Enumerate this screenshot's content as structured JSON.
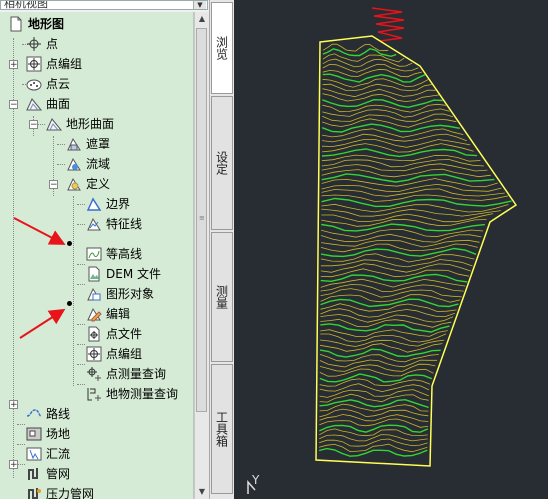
{
  "dropdown": {
    "label": "相机视图"
  },
  "tree": {
    "root": "地形图",
    "points": "点",
    "point_groups": "点编组",
    "point_clouds": "点云",
    "surfaces": "曲面",
    "surface_item": "地形曲面",
    "masks": "遮罩",
    "watersheds": "流域",
    "definition": "定义",
    "boundaries": "边界",
    "breaklines": "特征线",
    "contours": "等高线",
    "dem_files": "DEM 文件",
    "drawing_objects": "图形对象",
    "edits": "编辑",
    "point_files": "点文件",
    "point_groups_sub": "点编组",
    "point_survey_queries": "点测量查询",
    "figure_survey_queries": "地物测量查询",
    "alignments": "路线",
    "sites": "场地",
    "catchments": "汇流",
    "pipe_networks": "管网",
    "pressure_networks": "压力管网"
  },
  "tabs": {
    "browse": "浏览",
    "settings": "设定",
    "survey": "测量",
    "toolbox": "工具箱"
  },
  "canvas": {
    "ucs_axis": "Y"
  },
  "colors": {
    "tree_bg": "#d5ebd5",
    "canvas_bg": "#282c33",
    "contour_major": "#c9b52e",
    "contour_green": "#33d433",
    "boundary": "#ffff55",
    "arrow_red": "#e8141a"
  }
}
